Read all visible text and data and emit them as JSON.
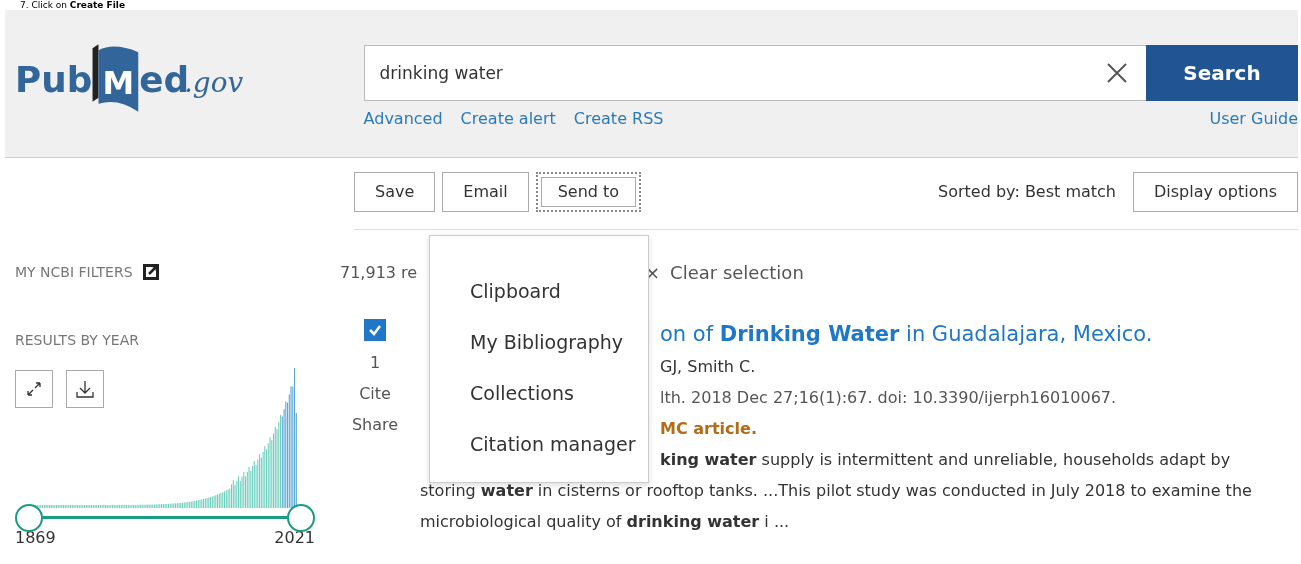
{
  "instruction": {
    "number": "7.",
    "text": "Click on **Create File**"
  },
  "logo": {
    "pub": "Pub",
    "m": "M",
    "ed": "ed",
    "gov": ".gov"
  },
  "header": {
    "search": {
      "value": "drinking water",
      "button": "Search"
    },
    "links": [
      "Advanced",
      "Create alert",
      "Create RSS"
    ],
    "user_guide": "User Guide"
  },
  "toolbar": {
    "buttons": [
      {
        "label": "Save",
        "focused": false
      },
      {
        "label": "Email",
        "focused": false
      },
      {
        "label": "Send to",
        "focused": true
      }
    ],
    "sorted_by": "Sorted by: Best match",
    "display_options": "Display options"
  },
  "send_to_menu": {
    "items": [
      "Clipboard",
      "My Bibliography",
      "Collections",
      "Citation manager"
    ]
  },
  "sidebar": {
    "filters_title": "MY NCBI FILTERS",
    "results_by_year": "RESULTS BY YEAR",
    "year_start": "1869",
    "year_end": "2021",
    "range_handles": [
      {
        "level": 0
      },
      {
        "level": 1
      }
    ]
  },
  "results": {
    "count": "71,913 re",
    "clear_selection": "Clear selection",
    "clear_icon": "×",
    "items": [
      {
        "selected": true,
        "number": "1",
        "cite": "Cite",
        "share": "Share",
        "title": "on of **Drinking Water** in Guadalajara, Mexico.",
        "authors": "GJ, Smith C.",
        "citation": "lth. 2018 Dec 27;16(1):67. doi: 10.3390/ijerph16010067.",
        "free": "MC article.",
        "snippet_first": "**king water** supply is intermittent and unreliable, households adapt by",
        "snippet": "storing **water** in cisterns or rooftop tanks. ...This pilot study was conducted in July 2018 to examine the microbiological quality of **drinking water** i ..."
      }
    ]
  }
}
